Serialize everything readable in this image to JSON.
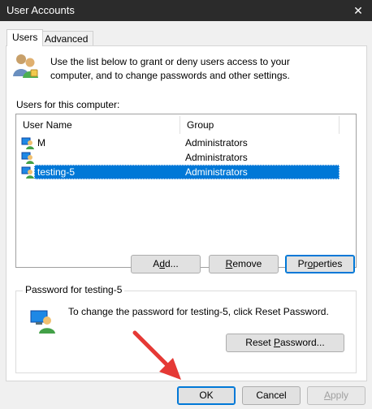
{
  "window": {
    "title": "User Accounts",
    "close_glyph": "✕"
  },
  "tabs": [
    {
      "label": "Users",
      "active": true
    },
    {
      "label": "Advanced",
      "active": false
    }
  ],
  "intro": {
    "text": "Use the list below to grant or deny users access to your computer, and to change passwords and other settings.",
    "icon": "users-icon"
  },
  "users_label": "Users for this computer:",
  "list": {
    "columns": [
      "User Name",
      "Group"
    ],
    "rows": [
      {
        "name": "M",
        "group": "Administrators",
        "selected": false
      },
      {
        "name": "",
        "group": "Administrators",
        "selected": false
      },
      {
        "name": "testing-5",
        "group": "Administrators",
        "selected": true
      }
    ]
  },
  "buttons": {
    "add": {
      "pre": "A",
      "u": "d",
      "post": "d..."
    },
    "remove": {
      "pre": "",
      "u": "R",
      "post": "emove"
    },
    "properties": {
      "pre": "Pr",
      "u": "o",
      "post": "perties"
    }
  },
  "password": {
    "group_title": "Password for testing-5",
    "text": "To change the password for testing-5, click Reset Password.",
    "reset": {
      "pre": "Reset ",
      "u": "P",
      "post": "assword..."
    }
  },
  "footer": {
    "ok": "OK",
    "cancel": "Cancel",
    "apply": {
      "pre": "",
      "u": "A",
      "post": "pply"
    }
  },
  "colors": {
    "accent": "#0078d7",
    "arrow": "#e53935",
    "titlebar": "#2b2b2b"
  }
}
